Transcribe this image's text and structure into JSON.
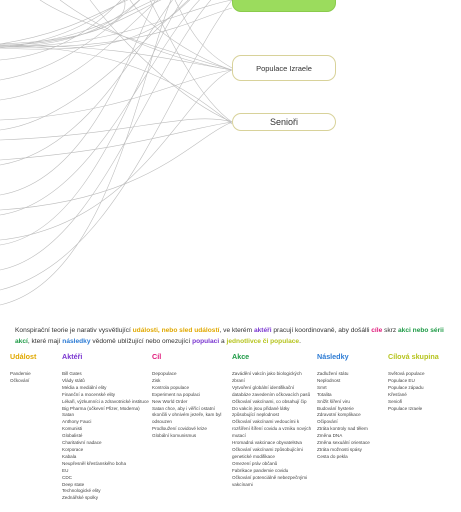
{
  "nodes": {
    "top": "",
    "izrael": "Populace Izraele",
    "seniori": "Senioři"
  },
  "intro": {
    "t1": "Konspirační teorie je narativ vysvětlující ",
    "h1": "události, nebo sled událostí",
    "t2": ", ve kterém ",
    "h2": "aktéři",
    "t3": " pracují koordinovaně, aby došálli ",
    "h3": "cíle",
    "t4": " skrz ",
    "h4": "akci nebo sérii akcí",
    "t5": ", které mají ",
    "h5": "následky",
    "t6": " vědomě ublížující nebo omezující ",
    "h6": "populaci",
    "t7": " a ",
    "h7": "jednotlivce či populace",
    "t8": "."
  },
  "columns": {
    "udalost": {
      "title": "Událost",
      "color": "#e0a800",
      "items": [
        "Pandemie",
        "Očkování"
      ]
    },
    "akteri": {
      "title": "Aktéři",
      "color": "#7a37d0",
      "items": [
        "Bill Gates",
        "Vlády států",
        "Média a mediální elity",
        "Finanční a mocenské elity",
        "Lékaři, výzkumníci a zdravotnické instituce",
        "Big Pharma (očkevní Pfizer, Moderna)",
        "Satan",
        "Anthony Fauci",
        "Komunisti",
        "Globalisté",
        "Charitativní nadace",
        "Korporace",
        "Kabala",
        "Neupřesněl křesťanského boha",
        "EU",
        "CDC",
        "Deep state",
        "Technologické elity",
        "Zednářské spolky"
      ]
    },
    "cil": {
      "title": "Cíl",
      "color": "#e0187a",
      "items": [
        "Depopulace",
        "Zisk",
        "Kontrola populace",
        "Experiment na populaci",
        "New World Order",
        "Satan chce, aby i věřící ostatní skončili v ohnivém jezeře, kam byl odsouzen",
        "Prodloužení covidové krize",
        "Globální komunismus"
      ]
    },
    "akce": {
      "title": "Akce",
      "color": "#1f9b47",
      "items": [
        "Zavádění vakcín jako biologických zbraní",
        "Vytvoření globální identifikační databáze zavedením očkovacích pasů",
        "Očkování vakcínami, co obsahují čip",
        "Do vakcín jsou přidané látky způsobující neplodnost",
        "Očkování vakcínami vedoucími k rozšíření šíření covidu a vzniku nových mutací",
        "Hromadná vakcinace obyvatelstva",
        "Očkování vakcínami způsobujícími genetické modifikace",
        "Omezení práv občanů",
        "Fabrikace pandemie covidu",
        "Očkování potenciálně nebezpečnými vakcínami"
      ]
    },
    "nasledky": {
      "title": "Následky",
      "color": "#2c7bd4",
      "items": [
        "Zadlužení státu",
        "Neplodnost",
        "Smrt",
        "Totalita",
        "Snížit šíření viru",
        "Budování hysterie",
        "Zdravotní komplikace",
        "Očipování",
        "Ztráta kontroly nad tělem",
        "Změna DNA",
        "Změna sexuální orientace",
        "Ztráta možnosti spásy",
        "Cesta do pekla"
      ]
    },
    "cilova": {
      "title": "Cílová skupina",
      "color": "#b6c41e",
      "items": [
        "Světová populace",
        "Populace EU",
        "Populace západu",
        "Křesťané",
        "Senioři",
        "Populace Izraele"
      ]
    }
  }
}
